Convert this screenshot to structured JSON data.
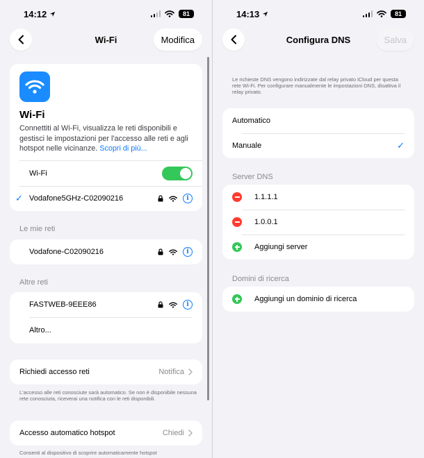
{
  "left": {
    "status": {
      "time": "14:12",
      "battery": "81"
    },
    "nav": {
      "title": "Wi-Fi",
      "edit": "Modifica"
    },
    "hero": {
      "title": "Wi-Fi",
      "description": "Connettiti al Wi-Fi, visualizza le reti disponibili e gestisci le impostazioni per l'accesso alle reti e agli hotspot nelle vicinanze.",
      "learn_more": "Scopri di più..."
    },
    "wifi_row": {
      "label": "Wi-Fi",
      "enabled": true
    },
    "connected": {
      "name": "Vodafone5GHz-C02090216"
    },
    "my_networks": {
      "header": "Le mie reti",
      "items": [
        {
          "name": "Vodafone-C02090216"
        }
      ]
    },
    "other_networks": {
      "header": "Altre reti",
      "items": [
        {
          "name": "FASTWEB-9EEE86"
        }
      ],
      "other": "Altro..."
    },
    "ask_join": {
      "label": "Richiedi accesso reti",
      "value": "Notifica",
      "footer": "L'accesso alle reti conosciute sarà automatico. Se non è disponibile nessuna rete conosciuta, riceverai una notifica con le reti disponibili."
    },
    "hotspot": {
      "label": "Accesso automatico hotspot",
      "value": "Chiedi",
      "footer": "Consenti al dispositivo di scoprire automaticamente hotspot"
    }
  },
  "right": {
    "status": {
      "time": "14:13",
      "battery": "81"
    },
    "nav": {
      "title": "Configura DNS",
      "save": "Salva"
    },
    "info": "Le richieste DNS vengono indirizzate dal relay privato iCloud per questa rete Wi-Fi. Per configurare manualmente le impostazioni DNS, disattiva il relay privato.",
    "modes": [
      {
        "label": "Automatico",
        "selected": false
      },
      {
        "label": "Manuale",
        "selected": true
      }
    ],
    "dns_servers": {
      "header": "Server DNS",
      "items": [
        "1.1.1.1",
        "1.0.0.1"
      ],
      "add": "Aggiungi server"
    },
    "search_domains": {
      "header": "Domini di ricerca",
      "add": "Aggiungi un dominio di ricerca"
    }
  },
  "colors": {
    "accent": "#0a7aff",
    "toggle_on": "#34c759",
    "remove": "#ff3b30",
    "add": "#34c759",
    "background": "#f2f2f7"
  },
  "icons": [
    "location-arrow-icon",
    "cellular-signal-icon",
    "wifi-icon",
    "battery-icon",
    "back-chevron-icon",
    "checkmark-icon",
    "lock-icon",
    "info-icon",
    "chevron-right-icon",
    "remove-icon",
    "add-icon"
  ]
}
